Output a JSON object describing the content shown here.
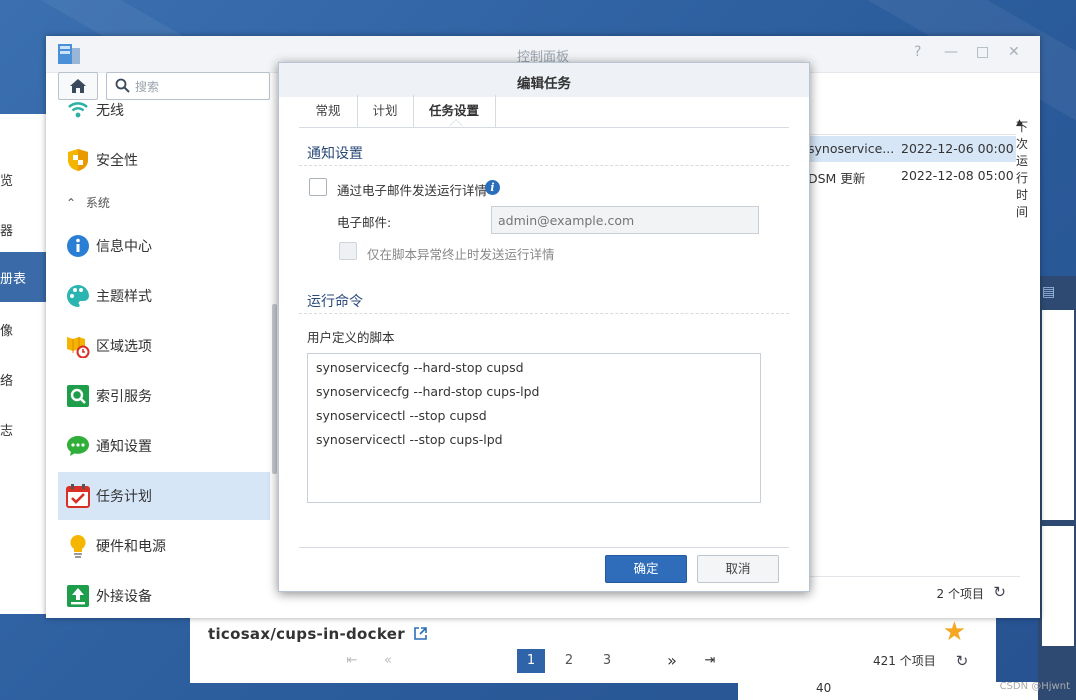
{
  "control_panel": {
    "title": "控制面板",
    "search_placeholder": "搜索",
    "sidebar": {
      "items_top": [
        {
          "label": "无线",
          "icon": "wifi-icon"
        },
        {
          "label": "安全性",
          "icon": "shield-icon"
        }
      ],
      "section": "系统",
      "items": [
        {
          "label": "信息中心",
          "icon": "info-center-icon"
        },
        {
          "label": "主题样式",
          "icon": "palette-icon"
        },
        {
          "label": "区域选项",
          "icon": "region-map-icon"
        },
        {
          "label": "索引服务",
          "icon": "index-search-icon"
        },
        {
          "label": "通知设置",
          "icon": "chat-bubble-icon"
        },
        {
          "label": "任务计划",
          "icon": "calendar-check-icon",
          "selected": true
        },
        {
          "label": "硬件和电源",
          "icon": "lightbulb-icon"
        },
        {
          "label": "外接设备",
          "icon": "upload-icon"
        }
      ]
    },
    "table": {
      "header_next_run": "下次运行时间",
      "rows": [
        {
          "name": "synoservice...",
          "next": "2022-12-06 00:00",
          "selected": true
        },
        {
          "name": "DSM 更新",
          "next": "2022-12-08 05:00"
        }
      ],
      "count": "2 个项目"
    }
  },
  "dialog": {
    "title": "编辑任务",
    "tabs": [
      "常规",
      "计划",
      "任务设置"
    ],
    "active_tab": "任务设置",
    "notify": {
      "section_title": "通知设置",
      "email_checkbox_label": "通过电子邮件发送运行详情",
      "email_label": "电子邮件:",
      "email_placeholder": "admin@example.com",
      "abnormal_only_label": "仅在脚本异常终止时发送运行详情"
    },
    "command": {
      "section_title": "运行命令",
      "script_label": "用户定义的脚本",
      "script_lines": [
        "synoservicecfg --hard-stop cupsd",
        "synoservicecfg --hard-stop cups-lpd",
        "synoservicectl --stop cupsd",
        "synoservicectl --stop cups-lpd"
      ]
    },
    "ok_label": "确定",
    "cancel_label": "取消"
  },
  "background_left": {
    "items": [
      "览",
      "器",
      "册表",
      "像",
      "络",
      "志"
    ]
  },
  "docker_window": {
    "title": "ticosax/cups-in-docker",
    "pages": [
      "1",
      "2",
      "3"
    ],
    "count": "421 个项目"
  },
  "background_bottom": {
    "number": "40"
  },
  "watermark": "CSDN @Hjwnt"
}
